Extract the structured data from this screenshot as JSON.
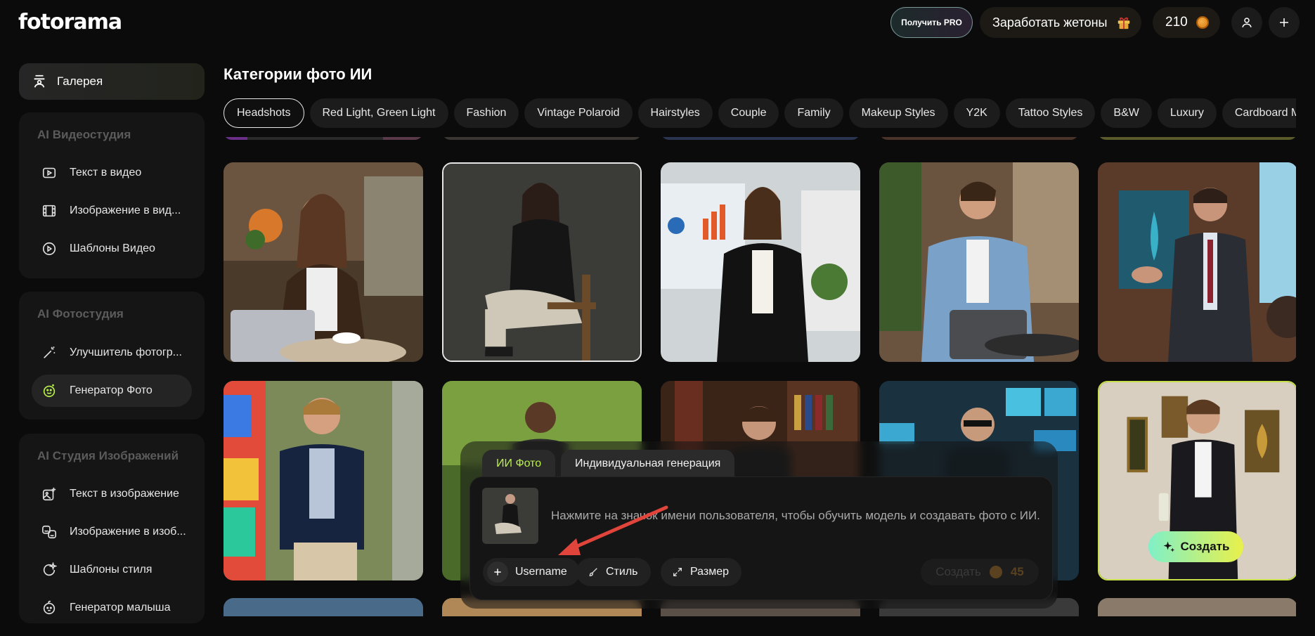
{
  "header": {
    "logo": "fotorama",
    "pro_label": "Получить PRO",
    "earn_label": "Заработать жетоны",
    "coins": "210"
  },
  "sidebar": {
    "gallery_label": "Галерея",
    "groups": [
      {
        "title": "AI Видеостудия",
        "items": [
          {
            "label": "Текст в видео"
          },
          {
            "label": "Изображение в вид..."
          },
          {
            "label": "Шаблоны Видео"
          }
        ]
      },
      {
        "title": "AI Фотостудия",
        "items": [
          {
            "label": "Улучшитель фотогр..."
          },
          {
            "label": "Генератор Фото"
          }
        ]
      },
      {
        "title": "AI Студия Изображений",
        "items": [
          {
            "label": "Текст в изображение"
          },
          {
            "label": "Изображение в изоб..."
          },
          {
            "label": "Шаблоны стиля"
          },
          {
            "label": "Генератор малыша"
          }
        ]
      }
    ]
  },
  "main": {
    "title": "Категории фото ИИ",
    "tabs": [
      "Headshots",
      "Red Light, Green Light",
      "Fashion",
      "Vintage Polaroid",
      "Hairstyles",
      "Couple",
      "Family",
      "Makeup Styles",
      "Y2K",
      "Tattoo Styles",
      "B&W",
      "Luxury",
      "Cardboard Men"
    ],
    "create_label": "Создать"
  },
  "prompt": {
    "tab_ai": "ИИ Фото",
    "tab_custom": "Индивидуальная генерация",
    "hint": "Нажмите на значок имени пользователя, чтобы обучить модель и создавать фото с ИИ.",
    "username_label": "Username",
    "style_label": "Стиль",
    "size_label": "Размер",
    "create_label": "Создать",
    "cost": "45"
  },
  "colors": {
    "accent_green": "#b8f04a",
    "create_gradient_start": "#7ff0c8",
    "create_gradient_end": "#e9f04a",
    "annotation_arrow": "#e0443a"
  }
}
